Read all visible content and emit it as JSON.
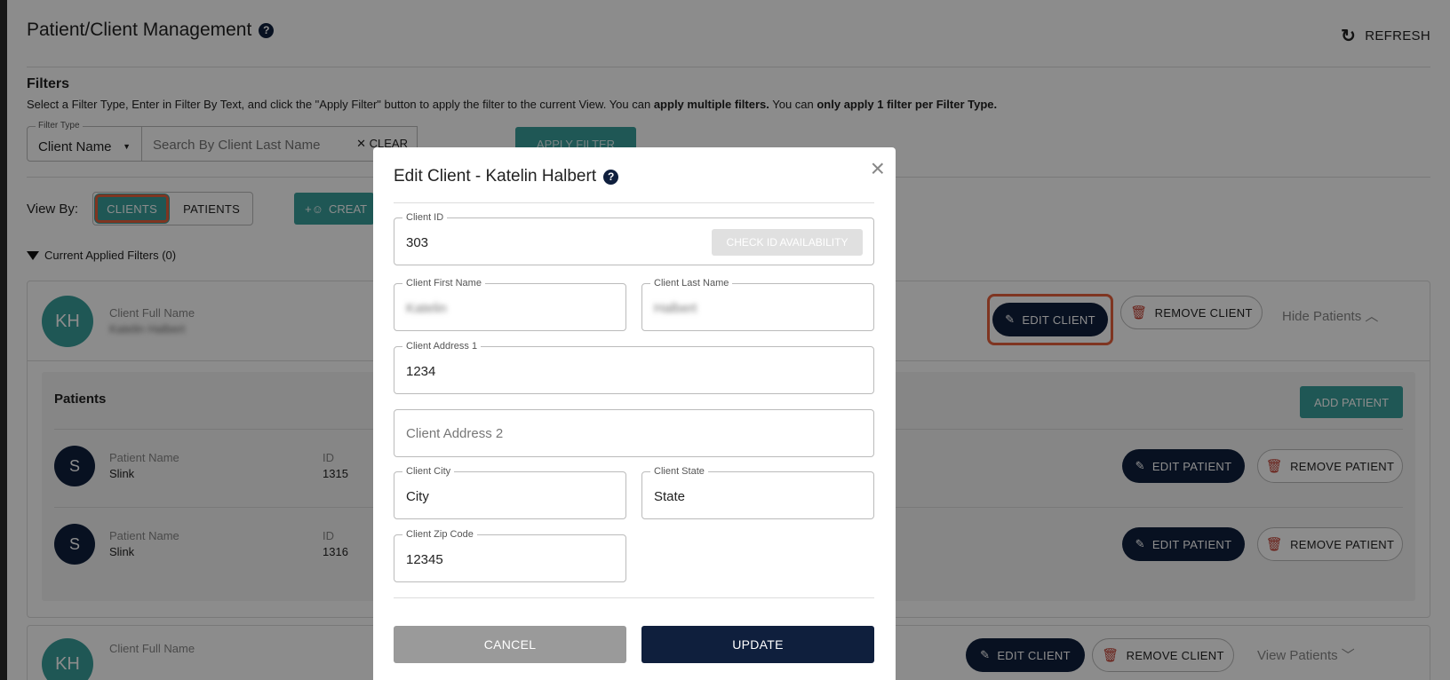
{
  "header": {
    "title": "Patient/Client Management",
    "refresh_label": "REFRESH"
  },
  "filters": {
    "title": "Filters",
    "help_pre": "Select a Filter Type, Enter in Filter By Text, and click the \"Apply Filter\" button to apply the filter to the current View. You can ",
    "help_bold1": "apply multiple filters.",
    "help_mid": " You can ",
    "help_bold2": "only apply 1 filter per Filter Type.",
    "filter_type_legend": "Filter Type",
    "filter_type_value": "Client Name",
    "search_placeholder": "Search By Client Last Name",
    "clear_label": "CLEAR",
    "apply_label": "APPLY FILTER"
  },
  "view_by": {
    "label": "View By:",
    "options": [
      "CLIENTS",
      "PATIENTS"
    ],
    "selected": "CLIENTS",
    "create_label": "CREAT"
  },
  "applied_filters": "Current Applied Filters (0)",
  "client_card": {
    "initials": "KH",
    "full_name_label": "Client Full Name",
    "full_name_value": "Katelin Halbert",
    "edit_label": "EDIT CLIENT",
    "remove_label": "REMOVE CLIENT",
    "hide_patients_label": "Hide Patients",
    "patients_title": "Patients",
    "add_patient_label": "ADD PATIENT",
    "patients": [
      {
        "initial": "S",
        "name_label": "Patient Name",
        "name": "Slink",
        "id_label": "ID",
        "id": "1315",
        "edit_label": "EDIT PATIENT",
        "remove_label": "REMOVE PATIENT"
      },
      {
        "initial": "S",
        "name_label": "Patient Name",
        "name": "Slink",
        "id_label": "ID",
        "id": "1316",
        "edit_label": "EDIT PATIENT",
        "remove_label": "REMOVE PATIENT"
      }
    ]
  },
  "client_card2": {
    "initials": "KH",
    "full_name_label": "Client Full Name",
    "edit_label": "EDIT CLIENT",
    "remove_label": "REMOVE CLIENT",
    "view_patients_label": "View Patients"
  },
  "modal": {
    "title": "Edit Client - Katelin Halbert",
    "fields": {
      "client_id": {
        "label": "Client ID",
        "value": "303"
      },
      "check_id_label": "CHECK ID AVAILABILITY",
      "first_name": {
        "label": "Client First Name",
        "value": "Katelin"
      },
      "last_name": {
        "label": "Client Last Name",
        "value": "Halbert"
      },
      "address1": {
        "label": "Client Address 1",
        "value": "1234"
      },
      "address2": {
        "placeholder": "Client Address 2"
      },
      "city": {
        "label": "Client City",
        "value": "City"
      },
      "state": {
        "label": "Client State",
        "value": "State"
      },
      "zip": {
        "label": "Client Zip Code",
        "value": "12345"
      }
    },
    "cancel_label": "CANCEL",
    "update_label": "UPDATE"
  },
  "colors": {
    "teal": "#3a9e9b",
    "navy": "#0f1f3d",
    "highlight": "#e8613c",
    "danger": "#c0392b"
  }
}
